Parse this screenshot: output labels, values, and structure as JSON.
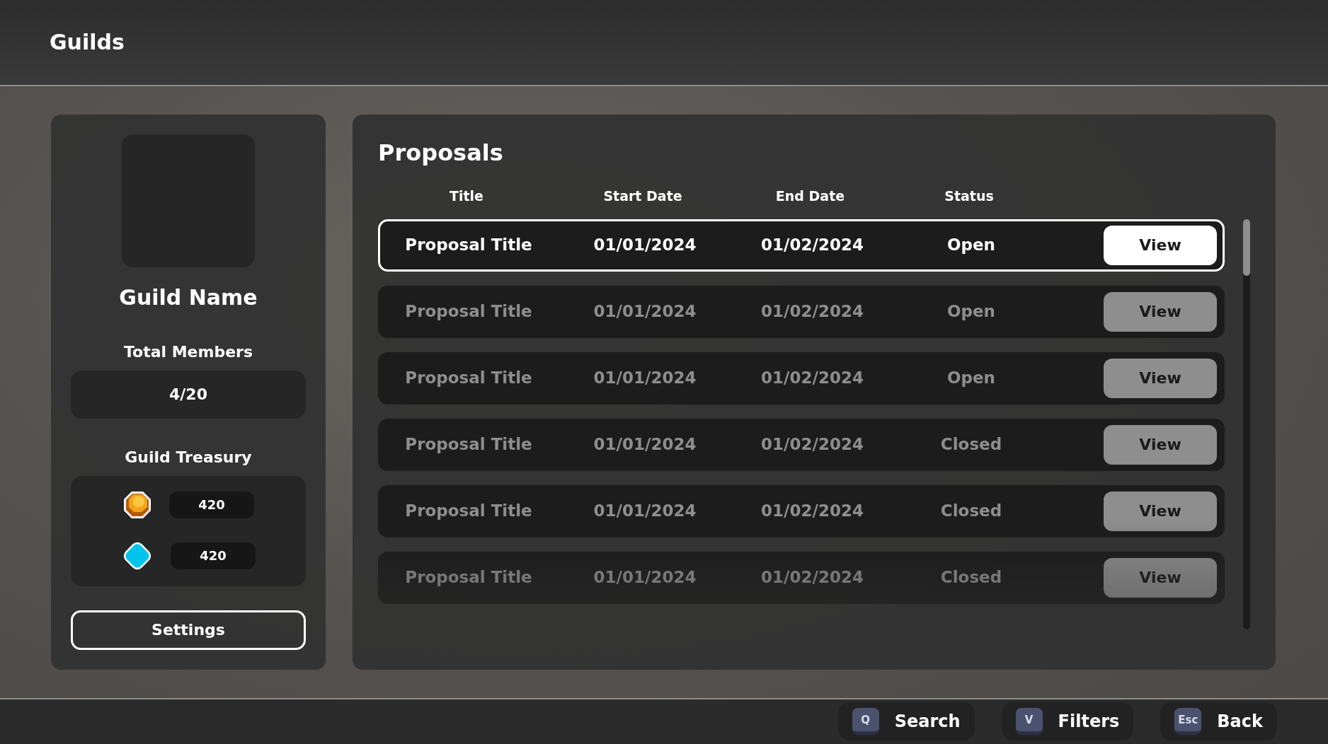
{
  "header": {
    "title": "Guilds"
  },
  "guild": {
    "name": "Guild Name",
    "members_label": "Total Members",
    "members": "4/20",
    "treasury_label": "Guild Treasury",
    "treasury": [
      {
        "kind": "coin",
        "amount": "420"
      },
      {
        "kind": "gem",
        "amount": "420"
      }
    ],
    "settings_button": "Settings"
  },
  "proposals": {
    "title": "Proposals",
    "columns": [
      "Title",
      "Start Date",
      "End Date",
      "Status"
    ],
    "rows": [
      {
        "title": "Proposal Title",
        "start": "01/01/2024",
        "end": "01/02/2024",
        "status": "Open",
        "action": "View",
        "selected": true
      },
      {
        "title": "Proposal Title",
        "start": "01/01/2024",
        "end": "01/02/2024",
        "status": "Open",
        "action": "View",
        "selected": false
      },
      {
        "title": "Proposal Title",
        "start": "01/01/2024",
        "end": "01/02/2024",
        "status": "Open",
        "action": "View",
        "selected": false
      },
      {
        "title": "Proposal Title",
        "start": "01/01/2024",
        "end": "01/02/2024",
        "status": "Closed",
        "action": "View",
        "selected": false
      },
      {
        "title": "Proposal Title",
        "start": "01/01/2024",
        "end": "01/02/2024",
        "status": "Closed",
        "action": "View",
        "selected": false
      },
      {
        "title": "Proposal Title",
        "start": "01/01/2024",
        "end": "01/02/2024",
        "status": "Closed",
        "action": "View",
        "selected": false
      }
    ]
  },
  "footer": [
    {
      "key": "Q",
      "label": "Search"
    },
    {
      "key": "V",
      "label": "Filters"
    },
    {
      "key": "Esc",
      "label": "Back"
    }
  ]
}
